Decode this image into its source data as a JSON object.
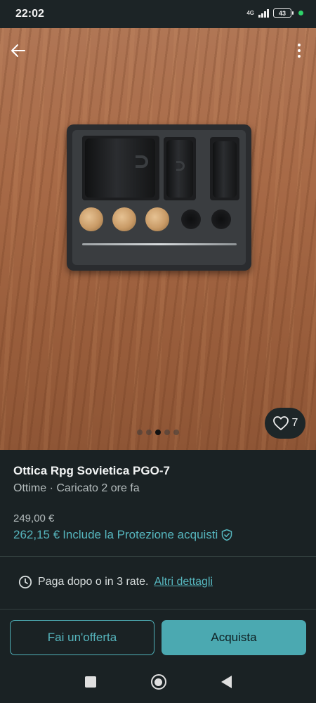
{
  "status": {
    "time": "22:02",
    "network": "4G",
    "battery": "43"
  },
  "photo": {
    "gallery_count": 5,
    "gallery_active_index": 2,
    "likes": "7"
  },
  "listing": {
    "title": "Ottica Rpg Sovietica PGO-7",
    "condition": "Ottime",
    "separator": "·",
    "uploaded": "Caricato 2 ore fa",
    "price": "249,00 €",
    "total_price": "262,15 €",
    "protection_text": "Include la Protezione acquisti"
  },
  "payment": {
    "text": "Paga dopo o in 3 rate.",
    "link": "Altri dettagli"
  },
  "actions": {
    "offer_label": "Fai un'offerta",
    "buy_label": "Acquista"
  },
  "colors": {
    "accent": "#56b6be",
    "background": "#1a2224",
    "buy_button": "#4ba9b1"
  }
}
